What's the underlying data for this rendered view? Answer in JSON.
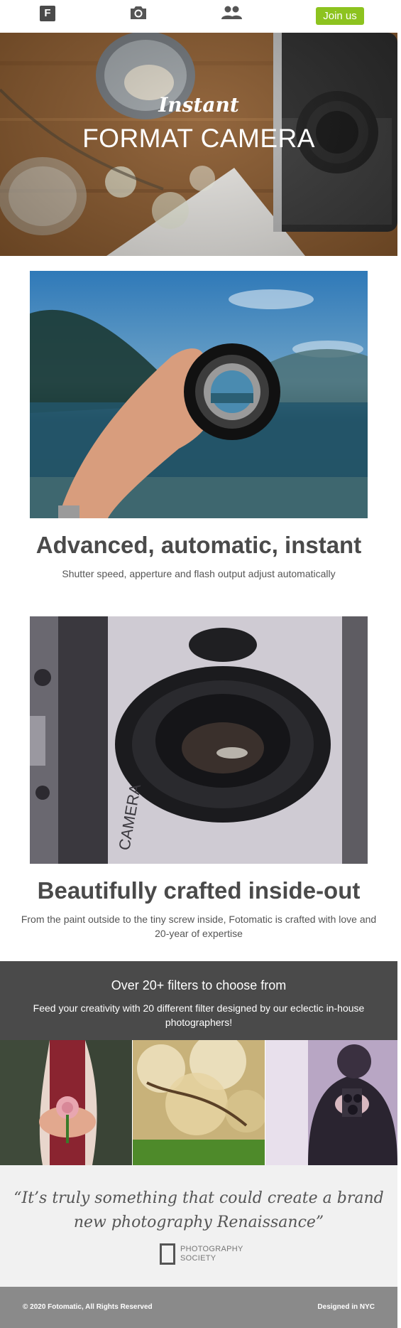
{
  "nav": {
    "logo_letter": "F",
    "icons": [
      "logo-f-icon",
      "camera-icon",
      "people-icon"
    ],
    "join_label": "Join us",
    "join_color": "#8dc31f"
  },
  "hero": {
    "script_text": "Instant",
    "title": "FORMAT CAMERA"
  },
  "features": [
    {
      "title": "Advanced, automatic, instant",
      "subtitle": "Shutter speed, apperture and flash output adjust automatically"
    },
    {
      "title": "Beautifully crafted inside-out",
      "subtitle": "From the paint outside to the tiny screw inside, Fotomatic is crafted with love and 20-year of expertise"
    }
  ],
  "filters": {
    "title": "Over 20+ filters to choose from",
    "subtitle": "Feed your creativity with 20 different filter designed by our eclectic in-house photographers!",
    "band_color": "#4a4a4a"
  },
  "testimonial": {
    "quote": "“It’s truly something that could create a brand new photography Renaissance”",
    "org_line1": "PHOTOGRAPHY",
    "org_line2": "SOCIETY"
  },
  "footer": {
    "copyright": "© 2020 Fotomatic, All Rights Reserved",
    "credit": "Designed in NYC"
  }
}
